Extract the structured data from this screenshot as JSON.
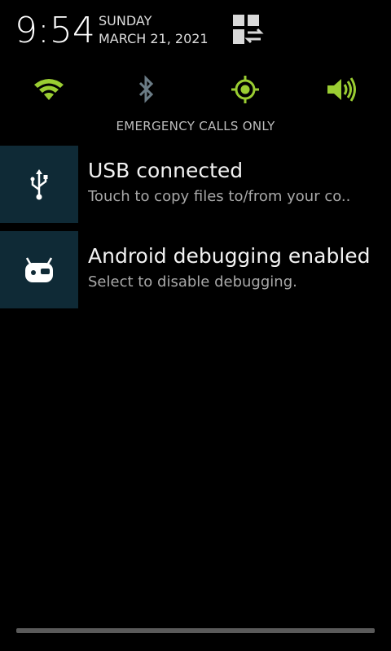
{
  "header": {
    "time": "9:54",
    "day": "SUNDAY",
    "date": "MARCH 21, 2021",
    "toggle_icon": "grid-swap-icon"
  },
  "quick_settings": [
    {
      "name": "wifi",
      "icon": "wifi-icon",
      "state": "on",
      "color": "#9ACD32"
    },
    {
      "name": "bluetooth",
      "icon": "bluetooth-icon",
      "state": "off",
      "color": "#6b7c86"
    },
    {
      "name": "location",
      "icon": "gps-icon",
      "state": "on",
      "color": "#9ACD32"
    },
    {
      "name": "sound",
      "icon": "volume-icon",
      "state": "on",
      "color": "#9ACD32"
    }
  ],
  "carrier_text": "EMERGENCY CALLS ONLY",
  "notifications": [
    {
      "icon": "usb-icon",
      "title": "USB connected",
      "text": "Touch to copy files to/from your co.."
    },
    {
      "icon": "android-debug-icon",
      "title": "Android debugging enabled",
      "text": "Select to disable debugging."
    }
  ],
  "colors": {
    "accent": "#9ACD32",
    "notification_icon_bg": "#0f2a36",
    "background": "#000000"
  }
}
